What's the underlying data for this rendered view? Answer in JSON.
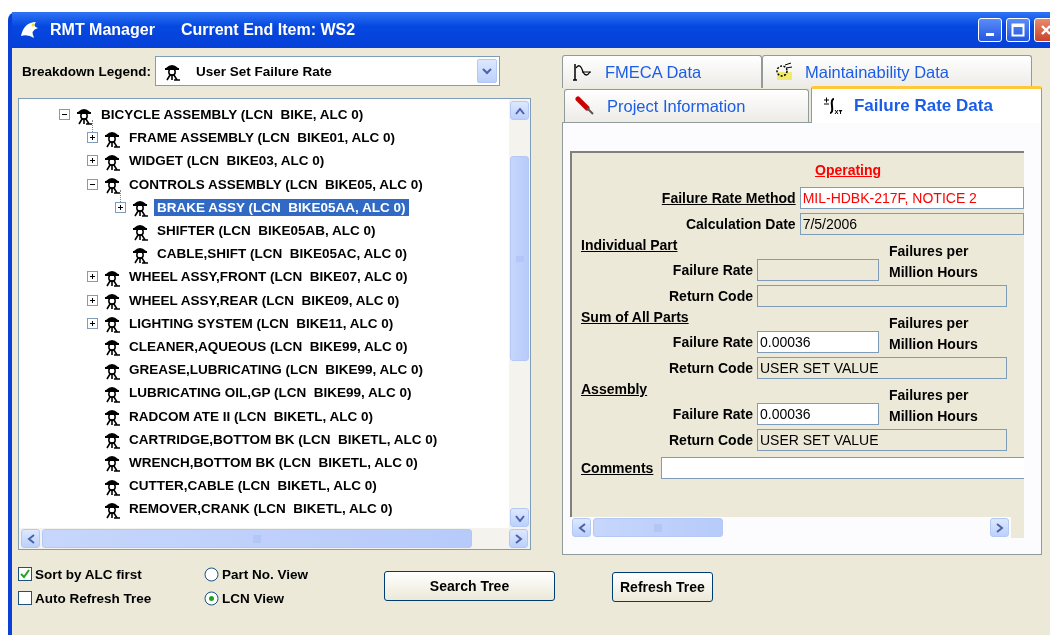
{
  "window": {
    "title": "RMT Manager",
    "subtitle": "Current End Item: WS2"
  },
  "breakdown_legend": {
    "label": "Breakdown Legend:",
    "value": "User Set Failure Rate"
  },
  "tree": {
    "items": [
      {
        "label": "BICYCLE ASSEMBLY (LCN  BIKE, ALC 0)",
        "kind": "branch",
        "expanded": true,
        "selected": false,
        "children": [
          {
            "label": "FRAME ASSEMBLY (LCN  BIKE01, ALC 0)",
            "kind": "branch",
            "expanded": false,
            "selected": false
          },
          {
            "label": "WIDGET (LCN  BIKE03, ALC 0)",
            "kind": "branch",
            "expanded": false,
            "selected": false
          },
          {
            "label": "CONTROLS ASSEMBLY (LCN  BIKE05, ALC 0)",
            "kind": "branch",
            "expanded": true,
            "selected": false,
            "children": [
              {
                "label": "BRAKE ASSY (LCN  BIKE05AA, ALC 0)",
                "kind": "branch",
                "expanded": false,
                "selected": true
              },
              {
                "label": "SHIFTER (LCN  BIKE05AB, ALC 0)",
                "kind": "leaf",
                "selected": false
              },
              {
                "label": "CABLE,SHIFT (LCN  BIKE05AC, ALC 0)",
                "kind": "leaf",
                "selected": false
              }
            ]
          },
          {
            "label": "WHEEL ASSY,FRONT (LCN  BIKE07, ALC 0)",
            "kind": "branch",
            "expanded": false,
            "selected": false
          },
          {
            "label": "WHEEL ASSY,REAR (LCN  BIKE09, ALC 0)",
            "kind": "branch",
            "expanded": false,
            "selected": false
          },
          {
            "label": "LIGHTING SYSTEM (LCN  BIKE11, ALC 0)",
            "kind": "branch",
            "expanded": false,
            "selected": false
          },
          {
            "label": "CLEANER,AQUEOUS (LCN  BIKE99, ALC 0)",
            "kind": "leaf",
            "selected": false
          },
          {
            "label": "GREASE,LUBRICATING (LCN  BIKE99, ALC 0)",
            "kind": "leaf",
            "selected": false
          },
          {
            "label": "LUBRICATING OIL,GP (LCN  BIKE99, ALC 0)",
            "kind": "leaf",
            "selected": false
          },
          {
            "label": "RADCOM ATE II (LCN  BIKETL, ALC 0)",
            "kind": "leaf",
            "selected": false
          },
          {
            "label": "CARTRIDGE,BOTTOM BK (LCN  BIKETL, ALC 0)",
            "kind": "leaf",
            "selected": false
          },
          {
            "label": "WRENCH,BOTTOM BK (LCN  BIKETL, ALC 0)",
            "kind": "leaf",
            "selected": false
          },
          {
            "label": "CUTTER,CABLE (LCN  BIKETL, ALC 0)",
            "kind": "leaf",
            "selected": false
          },
          {
            "label": "REMOVER,CRANK (LCN  BIKETL, ALC 0)",
            "kind": "leaf",
            "selected": false
          }
        ]
      }
    ]
  },
  "tab_rows": [
    [
      {
        "label": "FMECA Data",
        "selected": false
      },
      {
        "label": "Maintainability Data",
        "selected": false
      }
    ],
    [
      {
        "label": "Project Information",
        "selected": false
      },
      {
        "label": "Failure Rate Data",
        "selected": true
      }
    ]
  ],
  "failure_rate": {
    "heading": "Operating",
    "method": {
      "label": "Failure Rate Method",
      "value": "MIL-HDBK-217F, NOTICE 2"
    },
    "calculation_date": {
      "label": "Calculation Date",
      "value": "7/5/2006"
    },
    "sections": [
      {
        "title": "Individual Part",
        "units": "Failures per\nMillion Hours",
        "failure_rate": {
          "label": "Failure Rate"
        },
        "return_code": {
          "label": "Return Code"
        }
      },
      {
        "title": "Sum of All Parts",
        "units": "Failures per\nMillion Hours",
        "failure_rate": {
          "label": "Failure Rate",
          "value": "0.00036"
        },
        "return_code": {
          "label": "Return Code",
          "value": "USER SET VALUE"
        }
      },
      {
        "title": "Assembly",
        "units": "Failures per\nMillion Hours",
        "failure_rate": {
          "label": "Failure Rate",
          "value": "0.00036"
        },
        "return_code": {
          "label": "Return Code",
          "value": "USER SET VALUE"
        }
      }
    ],
    "comments": {
      "label": "Comments"
    }
  },
  "options": {
    "checkboxes": [
      {
        "label": "Sort by ALC first",
        "checked": true
      },
      {
        "label": "Auto Refresh Tree",
        "checked": false
      }
    ],
    "radios": [
      {
        "label": "Part No. View",
        "selected": false
      },
      {
        "label": "LCN View",
        "selected": true
      }
    ]
  },
  "buttons": [
    "Search Tree",
    "Refresh Tree"
  ]
}
